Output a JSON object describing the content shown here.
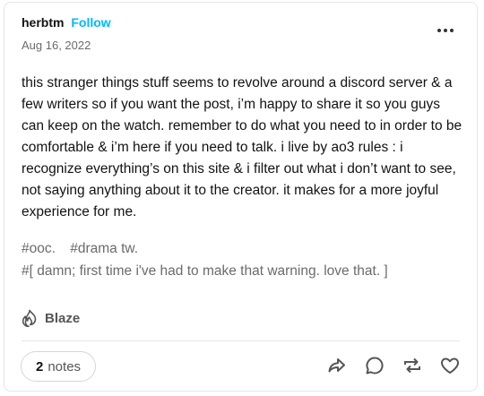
{
  "post": {
    "username": "herbtm",
    "follow_label": "Follow",
    "date": "Aug 16, 2022",
    "body": "this stranger things stuff seems to revolve around a discord server  &  a few writers so if you want the post,  i’m happy to share it so you guys can keep on the watch.   remember to do what you need to in order to be comfortable  &  i’m here if you need to talk.   i live by ao3 rules  :  i recognize everything’s on this site  &  i filter out what i don’t want to see,  not saying anything about it to the creator.   it makes for a more joyful experience for me.",
    "tags": [
      "#ooc.",
      "#drama tw.",
      "#[ damn; first time i've had to make that warning. love that. ]"
    ]
  },
  "blaze": {
    "label": "Blaze",
    "icon": "flame-icon"
  },
  "notes": {
    "count": "2",
    "label": "notes"
  },
  "actions": [
    {
      "name": "share-icon"
    },
    {
      "name": "comment-icon"
    },
    {
      "name": "reblog-icon"
    },
    {
      "name": "like-icon"
    }
  ],
  "colors": {
    "follow": "#00b8ff",
    "text": "#121212",
    "muted": "#6b6b6b"
  }
}
